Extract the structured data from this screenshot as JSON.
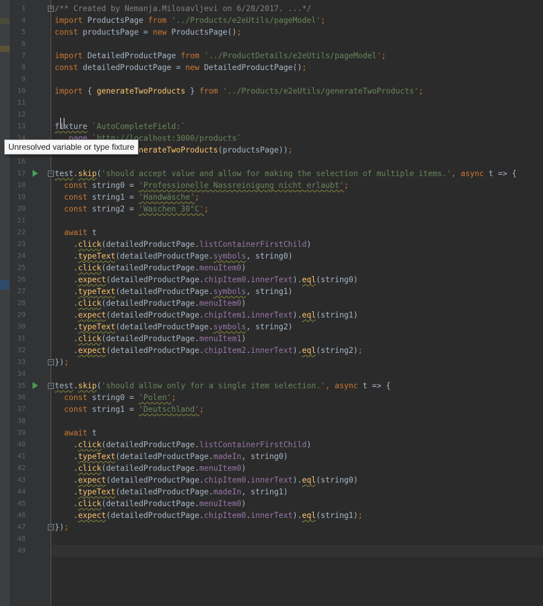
{
  "editor": {
    "tooltip": "Unresolved variable or type fixture",
    "lines": [
      {
        "no": "1",
        "fold": "+",
        "tokens": [
          {
            "t": "/** Created by Nemanja.Milosavljevi on 6/28/2017. ...*/",
            "c": "cmt"
          }
        ]
      },
      {
        "no": "4",
        "tokens": [
          {
            "t": "import",
            "c": "kw"
          },
          {
            "t": " ProductsPage ",
            "c": "id"
          },
          {
            "t": "from",
            "c": "kw"
          },
          {
            "t": " ",
            "c": "id"
          },
          {
            "t": "'../Products/e2eUtils/pageModel'",
            "c": "str"
          },
          {
            "t": ";",
            "c": "kw"
          }
        ]
      },
      {
        "no": "5",
        "tokens": [
          {
            "t": "const",
            "c": "kw"
          },
          {
            "t": " productsPage = ",
            "c": "id"
          },
          {
            "t": "new",
            "c": "kw"
          },
          {
            "t": " ProductsPage()",
            "c": "id"
          },
          {
            "t": ";",
            "c": "kw"
          }
        ]
      },
      {
        "no": "6",
        "tokens": []
      },
      {
        "no": "7",
        "tokens": [
          {
            "t": "import",
            "c": "kw"
          },
          {
            "t": " DetailedProductPage ",
            "c": "id"
          },
          {
            "t": "from",
            "c": "kw"
          },
          {
            "t": " ",
            "c": "id"
          },
          {
            "t": "'../ProductDetails/e2eUtils/pageModel'",
            "c": "str"
          },
          {
            "t": ";",
            "c": "kw"
          }
        ]
      },
      {
        "no": "8",
        "tokens": [
          {
            "t": "const",
            "c": "kw"
          },
          {
            "t": " detailedProductPage = ",
            "c": "id"
          },
          {
            "t": "new",
            "c": "kw"
          },
          {
            "t": " DetailedProductPage()",
            "c": "id"
          },
          {
            "t": ";",
            "c": "kw"
          }
        ]
      },
      {
        "no": "9",
        "tokens": []
      },
      {
        "no": "10",
        "tokens": [
          {
            "t": "import",
            "c": "kw"
          },
          {
            "t": " { ",
            "c": "id"
          },
          {
            "t": "generateTwoProducts",
            "c": "fn"
          },
          {
            "t": " } ",
            "c": "id"
          },
          {
            "t": "from",
            "c": "kw"
          },
          {
            "t": " ",
            "c": "id"
          },
          {
            "t": "'../Products/e2eUtils/generateTwoProducts'",
            "c": "str"
          },
          {
            "t": ";",
            "c": "kw"
          }
        ]
      },
      {
        "no": "11",
        "tokens": []
      },
      {
        "no": "12",
        "tokens": []
      },
      {
        "no": "13",
        "tokens": [
          {
            "t": "fixture",
            "c": "idw"
          },
          {
            "t": " ",
            "c": "id"
          },
          {
            "t": "`AutoCompleteField:`",
            "c": "str"
          }
        ]
      },
      {
        "no": "14",
        "tokens": [
          {
            "t": "  ",
            "c": "id"
          },
          {
            "t": ".page",
            "c": "prop"
          },
          {
            "t": " ",
            "c": "id"
          },
          {
            "t": "`http://localhost:3000/products`",
            "c": "str"
          }
        ]
      },
      {
        "no": "15",
        "tokens": [
          {
            "t": "  ",
            "c": "id"
          },
          {
            "t": ".before",
            "c": "prop"
          },
          {
            "t": "(() => ",
            "c": "id"
          },
          {
            "t": "generateTwoProducts",
            "c": "fn"
          },
          {
            "t": "(productsPage))",
            "c": "id"
          },
          {
            "t": ";",
            "c": "kw"
          }
        ]
      },
      {
        "no": "16",
        "tokens": []
      },
      {
        "no": "17",
        "fold": "-",
        "run": true,
        "tokens": [
          {
            "t": "test",
            "c": "idw"
          },
          {
            "t": ".",
            "c": "id"
          },
          {
            "t": "skip",
            "c": "fnw"
          },
          {
            "t": "(",
            "c": "id"
          },
          {
            "t": "'should accept value and allow for making the selection of multiple items.'",
            "c": "str"
          },
          {
            "t": ", ",
            "c": "kw"
          },
          {
            "t": "async",
            "c": "kw"
          },
          {
            "t": " t => {",
            "c": "id"
          }
        ]
      },
      {
        "no": "18",
        "tokens": [
          {
            "t": "  ",
            "c": "id"
          },
          {
            "t": "const",
            "c": "kw"
          },
          {
            "t": " string0 = ",
            "c": "id"
          },
          {
            "t": "'Professionelle Nassreinigung nicht erlaubt'",
            "c": "strw"
          },
          {
            "t": ";",
            "c": "kw"
          }
        ]
      },
      {
        "no": "19",
        "tokens": [
          {
            "t": "  ",
            "c": "id"
          },
          {
            "t": "const",
            "c": "kw"
          },
          {
            "t": " string1 = ",
            "c": "id"
          },
          {
            "t": "'Handwäsche'",
            "c": "strw"
          },
          {
            "t": ";",
            "c": "kw"
          }
        ]
      },
      {
        "no": "20",
        "tokens": [
          {
            "t": "  ",
            "c": "id"
          },
          {
            "t": "const",
            "c": "kw"
          },
          {
            "t": " string2 = ",
            "c": "id"
          },
          {
            "t": "'Waschen 30°C'",
            "c": "strw"
          },
          {
            "t": ";",
            "c": "kw"
          }
        ]
      },
      {
        "no": "21",
        "tokens": []
      },
      {
        "no": "22",
        "tokens": [
          {
            "t": "  ",
            "c": "id"
          },
          {
            "t": "await",
            "c": "kw"
          },
          {
            "t": " t",
            "c": "id"
          }
        ]
      },
      {
        "no": "23",
        "tokens": [
          {
            "t": "    .",
            "c": "id"
          },
          {
            "t": "click",
            "c": "fnw"
          },
          {
            "t": "(detailedProductPage.",
            "c": "id"
          },
          {
            "t": "listContainerFirstChild",
            "c": "prop"
          },
          {
            "t": ")",
            "c": "id"
          }
        ]
      },
      {
        "no": "24",
        "tokens": [
          {
            "t": "    .",
            "c": "id"
          },
          {
            "t": "typeText",
            "c": "fnw"
          },
          {
            "t": "(detailedProductPage.",
            "c": "id"
          },
          {
            "t": "symbols",
            "c": "propw"
          },
          {
            "t": ", string0)",
            "c": "id"
          }
        ]
      },
      {
        "no": "25",
        "tokens": [
          {
            "t": "    .",
            "c": "id"
          },
          {
            "t": "click",
            "c": "fnw"
          },
          {
            "t": "(detailedProductPage.",
            "c": "id"
          },
          {
            "t": "menuItem0",
            "c": "prop"
          },
          {
            "t": ")",
            "c": "id"
          }
        ]
      },
      {
        "no": "26",
        "tokens": [
          {
            "t": "    .",
            "c": "id"
          },
          {
            "t": "expect",
            "c": "fnw"
          },
          {
            "t": "(detailedProductPage.",
            "c": "id"
          },
          {
            "t": "chipItem0",
            "c": "prop"
          },
          {
            "t": ".",
            "c": "id"
          },
          {
            "t": "innerText",
            "c": "prop"
          },
          {
            "t": ").",
            "c": "id"
          },
          {
            "t": "eql",
            "c": "fnw"
          },
          {
            "t": "(string0)",
            "c": "id"
          }
        ]
      },
      {
        "no": "27",
        "tokens": [
          {
            "t": "    .",
            "c": "id"
          },
          {
            "t": "typeText",
            "c": "fnw"
          },
          {
            "t": "(detailedProductPage.",
            "c": "id"
          },
          {
            "t": "symbols",
            "c": "propw"
          },
          {
            "t": ", string1)",
            "c": "id"
          }
        ]
      },
      {
        "no": "28",
        "tokens": [
          {
            "t": "    .",
            "c": "id"
          },
          {
            "t": "click",
            "c": "fnw"
          },
          {
            "t": "(detailedProductPage.",
            "c": "id"
          },
          {
            "t": "menuItem0",
            "c": "prop"
          },
          {
            "t": ")",
            "c": "id"
          }
        ]
      },
      {
        "no": "29",
        "tokens": [
          {
            "t": "    .",
            "c": "id"
          },
          {
            "t": "expect",
            "c": "fnw"
          },
          {
            "t": "(detailedProductPage.",
            "c": "id"
          },
          {
            "t": "chipItem1",
            "c": "prop"
          },
          {
            "t": ".",
            "c": "id"
          },
          {
            "t": "innerText",
            "c": "prop"
          },
          {
            "t": ").",
            "c": "id"
          },
          {
            "t": "eql",
            "c": "fnw"
          },
          {
            "t": "(string1)",
            "c": "id"
          }
        ]
      },
      {
        "no": "30",
        "tokens": [
          {
            "t": "    .",
            "c": "id"
          },
          {
            "t": "typeText",
            "c": "fnw"
          },
          {
            "t": "(detailedProductPage.",
            "c": "id"
          },
          {
            "t": "symbols",
            "c": "propw"
          },
          {
            "t": ", string2)",
            "c": "id"
          }
        ]
      },
      {
        "no": "31",
        "tokens": [
          {
            "t": "    .",
            "c": "id"
          },
          {
            "t": "click",
            "c": "fnw"
          },
          {
            "t": "(detailedProductPage.",
            "c": "id"
          },
          {
            "t": "menuItem1",
            "c": "prop"
          },
          {
            "t": ")",
            "c": "id"
          }
        ]
      },
      {
        "no": "32",
        "tokens": [
          {
            "t": "    .",
            "c": "id"
          },
          {
            "t": "expect",
            "c": "fnw"
          },
          {
            "t": "(detailedProductPage.",
            "c": "id"
          },
          {
            "t": "chipItem2",
            "c": "prop"
          },
          {
            "t": ".",
            "c": "id"
          },
          {
            "t": "innerText",
            "c": "prop"
          },
          {
            "t": ").",
            "c": "id"
          },
          {
            "t": "eql",
            "c": "fnw"
          },
          {
            "t": "(string2)",
            "c": "id"
          },
          {
            "t": ";",
            "c": "kw"
          }
        ]
      },
      {
        "no": "33",
        "fold": "-",
        "tokens": [
          {
            "t": "})",
            "c": "id"
          },
          {
            "t": ";",
            "c": "kw"
          }
        ]
      },
      {
        "no": "34",
        "tokens": []
      },
      {
        "no": "35",
        "fold": "-",
        "run": true,
        "tokens": [
          {
            "t": "test",
            "c": "idw"
          },
          {
            "t": ".",
            "c": "id"
          },
          {
            "t": "skip",
            "c": "fnw"
          },
          {
            "t": "(",
            "c": "id"
          },
          {
            "t": "'should allow only for a single item selection.'",
            "c": "str"
          },
          {
            "t": ", ",
            "c": "kw"
          },
          {
            "t": "async",
            "c": "kw"
          },
          {
            "t": " t => {",
            "c": "id"
          }
        ]
      },
      {
        "no": "36",
        "tokens": [
          {
            "t": "  ",
            "c": "id"
          },
          {
            "t": "const",
            "c": "kw"
          },
          {
            "t": " string0 = ",
            "c": "id"
          },
          {
            "t": "'Polen'",
            "c": "strw"
          },
          {
            "t": ";",
            "c": "kw"
          }
        ]
      },
      {
        "no": "37",
        "tokens": [
          {
            "t": "  ",
            "c": "id"
          },
          {
            "t": "const",
            "c": "kw"
          },
          {
            "t": " string1 = ",
            "c": "id"
          },
          {
            "t": "'Deutschland'",
            "c": "strw"
          },
          {
            "t": ";",
            "c": "kw"
          }
        ]
      },
      {
        "no": "38",
        "tokens": []
      },
      {
        "no": "39",
        "tokens": [
          {
            "t": "  ",
            "c": "id"
          },
          {
            "t": "await",
            "c": "kw"
          },
          {
            "t": " t",
            "c": "id"
          }
        ]
      },
      {
        "no": "40",
        "tokens": [
          {
            "t": "    .",
            "c": "id"
          },
          {
            "t": "click",
            "c": "fnw"
          },
          {
            "t": "(detailedProductPage.",
            "c": "id"
          },
          {
            "t": "listContainerFirstChild",
            "c": "prop"
          },
          {
            "t": ")",
            "c": "id"
          }
        ]
      },
      {
        "no": "41",
        "tokens": [
          {
            "t": "    .",
            "c": "id"
          },
          {
            "t": "typeText",
            "c": "fnw"
          },
          {
            "t": "(detailedProductPage.",
            "c": "id"
          },
          {
            "t": "madeIn",
            "c": "prop"
          },
          {
            "t": ", string0)",
            "c": "id"
          }
        ]
      },
      {
        "no": "42",
        "tokens": [
          {
            "t": "    .",
            "c": "id"
          },
          {
            "t": "click",
            "c": "fnw"
          },
          {
            "t": "(detailedProductPage.",
            "c": "id"
          },
          {
            "t": "menuItem0",
            "c": "prop"
          },
          {
            "t": ")",
            "c": "id"
          }
        ]
      },
      {
        "no": "43",
        "tokens": [
          {
            "t": "    .",
            "c": "id"
          },
          {
            "t": "expect",
            "c": "fnw"
          },
          {
            "t": "(detailedProductPage.",
            "c": "id"
          },
          {
            "t": "chipItem0",
            "c": "prop"
          },
          {
            "t": ".",
            "c": "id"
          },
          {
            "t": "innerText",
            "c": "prop"
          },
          {
            "t": ").",
            "c": "id"
          },
          {
            "t": "eql",
            "c": "fnw"
          },
          {
            "t": "(string0)",
            "c": "id"
          }
        ]
      },
      {
        "no": "44",
        "tokens": [
          {
            "t": "    .",
            "c": "id"
          },
          {
            "t": "typeText",
            "c": "fnw"
          },
          {
            "t": "(detailedProductPage.",
            "c": "id"
          },
          {
            "t": "madeIn",
            "c": "prop"
          },
          {
            "t": ", string1)",
            "c": "id"
          }
        ]
      },
      {
        "no": "45",
        "tokens": [
          {
            "t": "    .",
            "c": "id"
          },
          {
            "t": "click",
            "c": "fnw"
          },
          {
            "t": "(detailedProductPage.",
            "c": "id"
          },
          {
            "t": "menuItem0",
            "c": "prop"
          },
          {
            "t": ")",
            "c": "id"
          }
        ]
      },
      {
        "no": "46",
        "tokens": [
          {
            "t": "    .",
            "c": "id"
          },
          {
            "t": "expect",
            "c": "fnw"
          },
          {
            "t": "(detailedProductPage.",
            "c": "id"
          },
          {
            "t": "chipItem0",
            "c": "prop"
          },
          {
            "t": ".",
            "c": "id"
          },
          {
            "t": "innerText",
            "c": "prop"
          },
          {
            "t": ").",
            "c": "id"
          },
          {
            "t": "eql",
            "c": "fnw"
          },
          {
            "t": "(string1)",
            "c": "id"
          },
          {
            "t": ";",
            "c": "kw"
          }
        ]
      },
      {
        "no": "47",
        "fold": "-",
        "tokens": [
          {
            "t": "})",
            "c": "id"
          },
          {
            "t": ";",
            "c": "kw"
          }
        ]
      },
      {
        "no": "48",
        "tokens": []
      },
      {
        "no": "49",
        "current": true,
        "tokens": []
      }
    ]
  },
  "colors": {
    "background": "#2b2b2b",
    "gutter": "#313335",
    "keyword": "#cc7832",
    "string": "#6a8759",
    "comment": "#808080",
    "function": "#ffc66d",
    "property": "#9876aa",
    "identifier": "#a9b7c6",
    "run_icon": "#499c54"
  }
}
